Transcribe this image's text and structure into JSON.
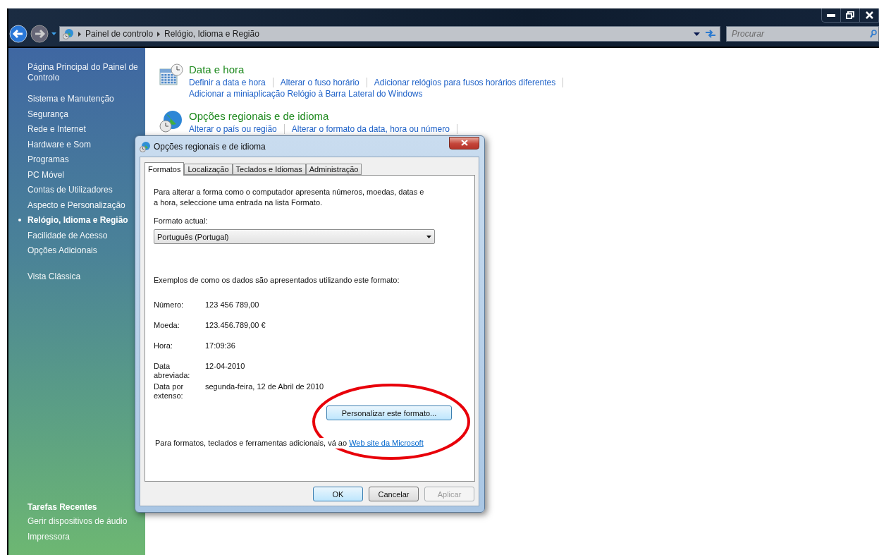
{
  "address_bar": {
    "breadcrumbs": [
      "Painel de controlo",
      "Relógio, Idioma e Região"
    ]
  },
  "search": {
    "placeholder": "Procurar"
  },
  "sidebar": {
    "items": [
      {
        "label": "Página Principal do Painel de Controlo",
        "selected": false
      },
      {
        "label": "Sistema e Manutenção",
        "selected": false
      },
      {
        "label": "Segurança",
        "selected": false
      },
      {
        "label": "Rede e Internet",
        "selected": false
      },
      {
        "label": "Hardware e Som",
        "selected": false
      },
      {
        "label": "Programas",
        "selected": false
      },
      {
        "label": "PC Móvel",
        "selected": false
      },
      {
        "label": "Contas de Utilizadores",
        "selected": false
      },
      {
        "label": "Aspecto e Personalização",
        "selected": false
      },
      {
        "label": "Relógio, Idioma e Região",
        "selected": true
      },
      {
        "label": "Facilidade de Acesso",
        "selected": false
      },
      {
        "label": "Opções Adicionais",
        "selected": false
      }
    ],
    "classic_view": "Vista Clássica",
    "recent_title": "Tarefas Recentes",
    "recent_items": [
      "Gerir dispositivos de áudio",
      "Impressora"
    ]
  },
  "sections": [
    {
      "kind": "clock",
      "title": "Data e hora",
      "lines": [
        [
          "Definir a data e hora",
          "Alterar o fuso horário",
          "Adicionar relógios para fusos horários diferentes"
        ],
        [
          "Adicionar a miniaplicação Relógio à Barra Lateral do Windows"
        ]
      ]
    },
    {
      "kind": "globe",
      "title": "Opções regionais e de idioma",
      "lines": [
        [
          "Alterar o país ou região",
          "Alterar o formato da data, hora ou número"
        ]
      ]
    }
  ],
  "dialog": {
    "title": "Opções regionais e de idioma",
    "tabs": [
      {
        "label": "Formatos",
        "selected": true
      },
      {
        "label": "Localização",
        "selected": false
      },
      {
        "label": "Teclados e Idiomas",
        "selected": false
      },
      {
        "label": "Administração",
        "selected": false
      }
    ],
    "intro": "Para alterar a forma como o computador apresenta números, moedas, datas e a hora, seleccione uma entrada na lista Formato.",
    "format_label": "Formato actual:",
    "format_value": "Português (Portugal)",
    "examples_label": "Exemplos de como os dados são apresentados utilizando este formato:",
    "examples": [
      {
        "label": "Número:",
        "value": "123 456 789,00"
      },
      {
        "label": "Moeda:",
        "value": "123.456.789,00 €"
      },
      {
        "label": "Hora:",
        "value": "17:09:36"
      },
      {
        "label": "Data abreviada:",
        "value": "12-04-2010"
      },
      {
        "label": "Data por extenso:",
        "value": "segunda-feira, 12 de Abril de 2010"
      }
    ],
    "customize_button": "Personalizar este formato...",
    "footer_text": "Para formatos, teclados e ferramentas adicionais, vá ao",
    "footer_link": "Web site da Microsoft",
    "buttons": [
      {
        "label": "OK",
        "disabled": false,
        "default": true
      },
      {
        "label": "Cancelar",
        "disabled": false,
        "default": false
      },
      {
        "label": "Aplicar",
        "disabled": true,
        "default": false
      }
    ]
  },
  "annotation": {
    "kind": "ellipse"
  }
}
